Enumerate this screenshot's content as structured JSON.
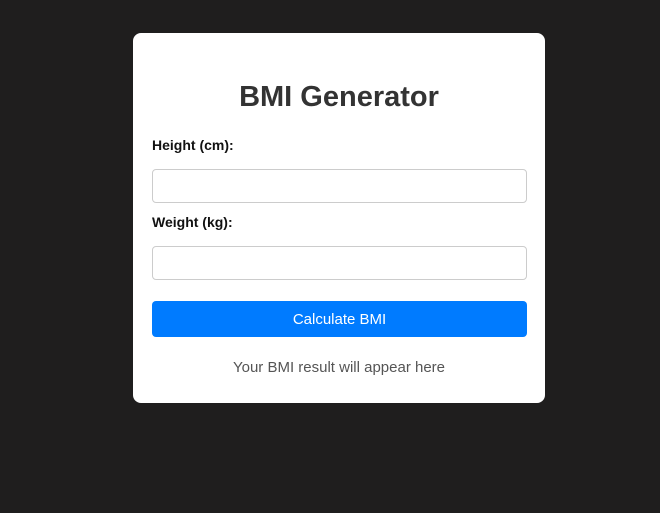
{
  "app": {
    "title": "BMI Generator"
  },
  "form": {
    "height_label": "Height (cm):",
    "height_value": "",
    "weight_label": "Weight (kg):",
    "weight_value": "",
    "submit_label": "Calculate BMI"
  },
  "result": {
    "text": "Your BMI result will appear here"
  },
  "colors": {
    "background": "#1f1e1e",
    "card": "#ffffff",
    "button": "#007bff",
    "title": "#333333"
  }
}
